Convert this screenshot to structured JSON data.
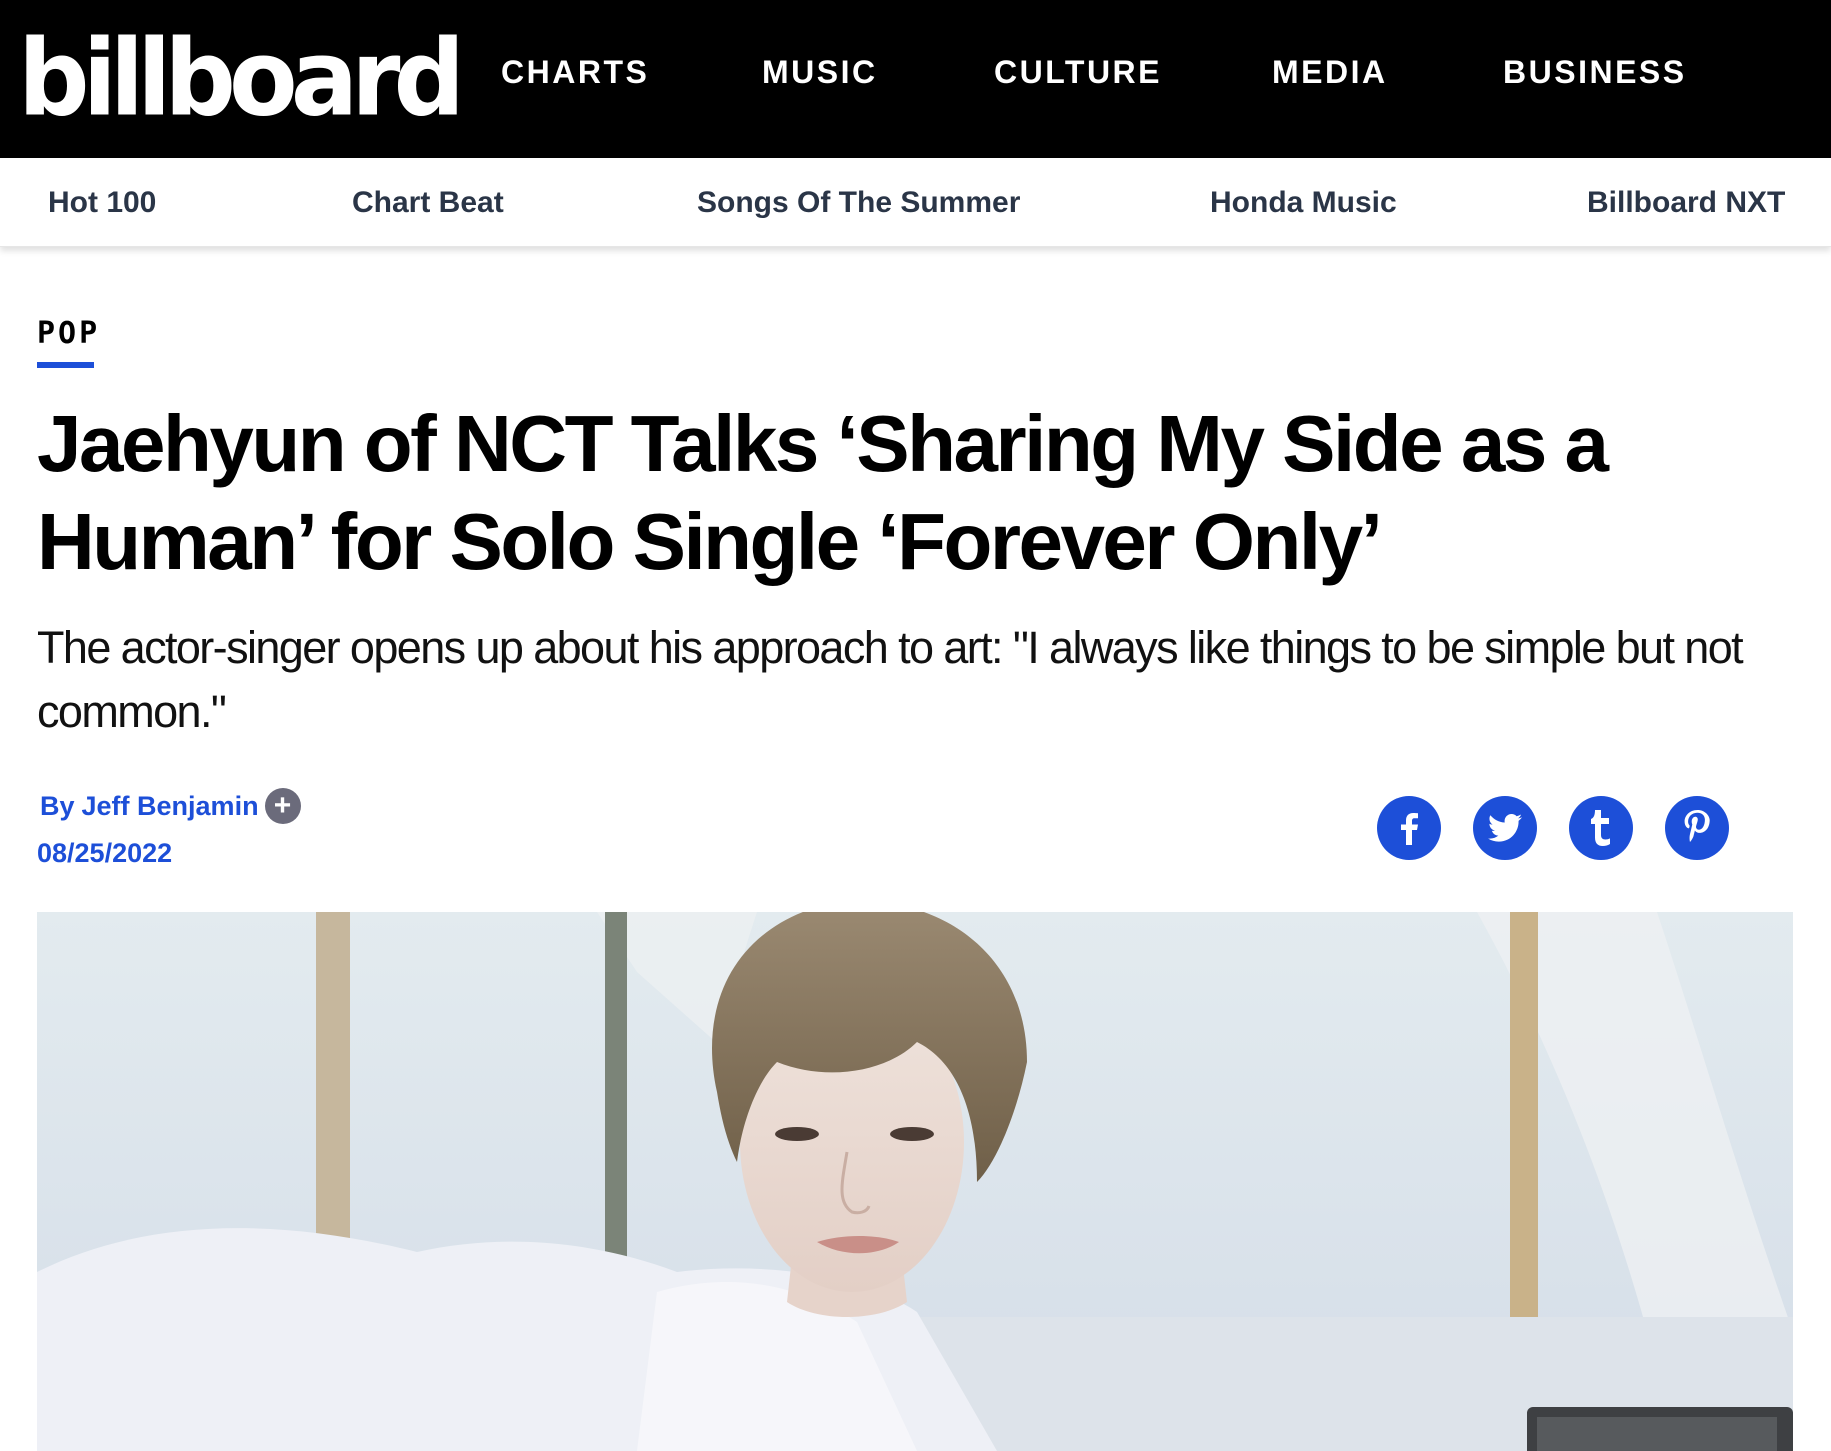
{
  "brand": {
    "logo_text": "billboard"
  },
  "main_nav": {
    "items": [
      "CHARTS",
      "MUSIC",
      "CULTURE",
      "MEDIA",
      "BUSINESS"
    ]
  },
  "sub_nav": {
    "items": [
      "Hot 100",
      "Chart Beat",
      "Songs Of The Summer",
      "Honda Music",
      "Billboard NXT"
    ]
  },
  "article": {
    "category": "POP",
    "headline": "Jaehyun of NCT Talks ‘Sharing My Side as a Human’ for Solo Single ‘Forever Only’",
    "dek": "The actor-singer opens up about his approach to art: \"I always like things to be simple but not common.\"",
    "byline_prefix": "By",
    "author": "Jeff Benjamin",
    "date": "08/25/2022"
  },
  "share": {
    "icons": [
      "facebook-icon",
      "twitter-icon",
      "tumblr-icon",
      "pinterest-icon"
    ]
  },
  "colors": {
    "accent": "#1d4fd8",
    "topbar": "#000000",
    "subnav_text": "#2a3547",
    "plus_badge": "#6b6b7b"
  }
}
